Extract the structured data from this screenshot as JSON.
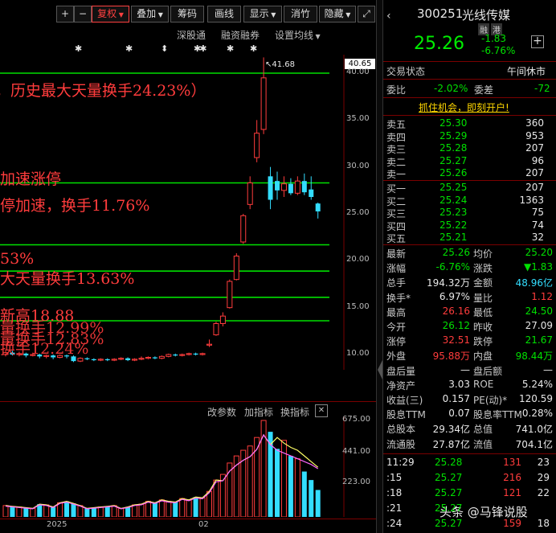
{
  "toolbar": {
    "plus": "+",
    "minus": "−",
    "fuquan": "复权",
    "overlay": "叠加",
    "chips": "筹码",
    "draw": "画线",
    "display": "显示",
    "review": "消竹",
    "hide": "隐藏",
    "fullscreen": "⤢"
  },
  "subtoolbar": {
    "shsz": "深股通",
    "margin": "融资融券",
    "settings": "设置均线"
  },
  "price_axis": {
    "current": "40.65",
    "labels": [
      "40.00",
      "35.00",
      "30.00",
      "25.00",
      "20.00",
      "15.00",
      "10.00"
    ]
  },
  "peak_label": "41.68",
  "annotations": [
    "，历史最大天量换手24.23%）",
    "加速涨停",
    "停加速，换手11.76%",
    "53%",
    "大天量换手13.63%",
    "新高18.88",
    "量换手12.99%",
    "量换手12.83%",
    "换手12.24%"
  ],
  "volume_panel": {
    "btn_params": "改参数",
    "btn_add": "加指标",
    "btn_switch": "换指标",
    "close": "✕",
    "labels": [
      "675.00",
      "441.00",
      "223.00"
    ]
  },
  "xaxis": {
    "year": "2025",
    "month": "02"
  },
  "stock": {
    "code": "300251",
    "name": "光线传媒",
    "badge1": "融",
    "badge2": "港",
    "price": "25.26",
    "change": "-1.83",
    "change_pct": "-6.76%"
  },
  "status": {
    "label": "交易状态",
    "value": "午间休市"
  },
  "ratio": {
    "wb_label": "委比",
    "wb_value": "-2.02%",
    "wc_label": "委差",
    "wc_value": "-72"
  },
  "promo": "抓住机会，即刻开户!",
  "asks": [
    {
      "label": "卖五",
      "price": "25.30",
      "vol": "360"
    },
    {
      "label": "卖四",
      "price": "25.29",
      "vol": "953"
    },
    {
      "label": "卖三",
      "price": "25.28",
      "vol": "207"
    },
    {
      "label": "卖二",
      "price": "25.27",
      "vol": "96"
    },
    {
      "label": "卖一",
      "price": "25.26",
      "vol": "207"
    }
  ],
  "bids": [
    {
      "label": "买一",
      "price": "25.25",
      "vol": "207"
    },
    {
      "label": "买二",
      "price": "25.24",
      "vol": "1363"
    },
    {
      "label": "买三",
      "price": "25.23",
      "vol": "75"
    },
    {
      "label": "买四",
      "price": "25.22",
      "vol": "74"
    },
    {
      "label": "买五",
      "price": "25.21",
      "vol": "32"
    }
  ],
  "stats": [
    {
      "l1": "最新",
      "v1": "25.26",
      "l2": "均价",
      "v2": "25.20"
    },
    {
      "l1": "涨幅",
      "v1": "-6.76%",
      "l2": "涨跌",
      "v2": "▼1.83"
    },
    {
      "l1": "总手",
      "v1": "194.32万",
      "l2": "金额",
      "v2": "48.96亿"
    },
    {
      "l1": "换手*",
      "v1": "6.97%",
      "l2": "量比",
      "v2": "1.12"
    },
    {
      "l1": "最高",
      "v1": "26.16",
      "l2": "最低",
      "v2": "24.50"
    },
    {
      "l1": "今开",
      "v1": "26.12",
      "l2": "昨收",
      "v2": "27.09"
    },
    {
      "l1": "涨停",
      "v1": "32.51",
      "l2": "跌停",
      "v2": "21.67"
    },
    {
      "l1": "外盘",
      "v1": "95.88万",
      "l2": "内盘",
      "v2": "98.44万"
    },
    {
      "l1": "盘后量",
      "v1": "—",
      "l2": "盘后额",
      "v2": "—"
    },
    {
      "l1": "净资产",
      "v1": "3.03",
      "l2": "ROE",
      "v2": "5.24%"
    },
    {
      "l1": "收益(三)",
      "v1": "0.157",
      "l2": "PE(动)*",
      "v2": "120.59"
    },
    {
      "l1": "股息TTM",
      "v1": "0.07",
      "l2": "股息率TTM",
      "v2": "0.28%"
    },
    {
      "l1": "总股本",
      "v1": "29.34亿",
      "l2": "总值",
      "v2": "741.0亿"
    },
    {
      "l1": "流通股",
      "v1": "27.87亿",
      "l2": "流值",
      "v2": "704.1亿"
    }
  ],
  "ticks": [
    {
      "t": "11:29",
      "p": "25.28",
      "v": "131",
      "n": "23"
    },
    {
      "t": ":15",
      "p": "25.27",
      "v": "216",
      "n": "29"
    },
    {
      "t": ":18",
      "p": "25.27",
      "v": "121",
      "n": "22"
    },
    {
      "t": ":21",
      "p": "25.27",
      "v": "",
      "n": ""
    },
    {
      "t": ":24",
      "p": "25.27",
      "v": "159",
      "n": "18"
    }
  ],
  "watermark": "头条 @马锋说股",
  "colors": {
    "up": "#ff3c3c",
    "down": "#33ddff",
    "line": "#00e000",
    "bg": "#000000"
  },
  "chart_data": {
    "type": "candlestick",
    "ylim": [
      9.5,
      41.68
    ],
    "candles": [
      {
        "o": 10.0,
        "c": 10.2,
        "h": 10.4,
        "l": 9.8
      },
      {
        "o": 10.2,
        "c": 10.0,
        "h": 10.4,
        "l": 9.9
      },
      {
        "o": 10.0,
        "c": 10.1,
        "h": 10.3,
        "l": 9.8
      },
      {
        "o": 10.1,
        "c": 9.9,
        "h": 10.2,
        "l": 9.7
      },
      {
        "o": 9.9,
        "c": 10.0,
        "h": 10.2,
        "l": 9.8
      },
      {
        "o": 10.0,
        "c": 9.8,
        "h": 10.1,
        "l": 9.6
      },
      {
        "o": 9.8,
        "c": 9.9,
        "h": 10.0,
        "l": 9.6
      },
      {
        "o": 9.9,
        "c": 9.7,
        "h": 10.0,
        "l": 9.5
      },
      {
        "o": 9.7,
        "c": 9.9,
        "h": 10.0,
        "l": 9.6
      },
      {
        "o": 9.9,
        "c": 9.8,
        "h": 10.0,
        "l": 9.6
      },
      {
        "o": 9.8,
        "c": 9.3,
        "h": 9.9,
        "l": 9.2
      },
      {
        "o": 9.3,
        "c": 9.6,
        "h": 9.7,
        "l": 9.2
      },
      {
        "o": 9.6,
        "c": 9.5,
        "h": 9.7,
        "l": 9.4
      },
      {
        "o": 9.5,
        "c": 9.4,
        "h": 9.6,
        "l": 9.3
      },
      {
        "o": 9.4,
        "c": 9.5,
        "h": 9.6,
        "l": 9.3
      },
      {
        "o": 9.5,
        "c": 9.4,
        "h": 9.6,
        "l": 9.3
      },
      {
        "o": 9.4,
        "c": 9.5,
        "h": 9.6,
        "l": 9.3
      },
      {
        "o": 9.5,
        "c": 9.6,
        "h": 9.7,
        "l": 9.4
      },
      {
        "o": 9.6,
        "c": 9.4,
        "h": 9.7,
        "l": 9.3
      },
      {
        "o": 9.4,
        "c": 9.5,
        "h": 9.6,
        "l": 9.3
      },
      {
        "o": 9.5,
        "c": 9.6,
        "h": 9.8,
        "l": 9.4
      },
      {
        "o": 9.6,
        "c": 9.7,
        "h": 9.8,
        "l": 9.5
      },
      {
        "o": 9.7,
        "c": 9.6,
        "h": 9.8,
        "l": 9.5
      },
      {
        "o": 9.6,
        "c": 9.8,
        "h": 9.9,
        "l": 9.5
      },
      {
        "o": 9.8,
        "c": 10.0,
        "h": 10.1,
        "l": 9.7
      },
      {
        "o": 10.0,
        "c": 9.9,
        "h": 10.1,
        "l": 9.8
      },
      {
        "o": 9.9,
        "c": 10.0,
        "h": 10.1,
        "l": 9.8
      },
      {
        "o": 10.0,
        "c": 10.1,
        "h": 10.2,
        "l": 9.9
      },
      {
        "o": 10.1,
        "c": 10.0,
        "h": 10.2,
        "l": 9.9
      },
      {
        "o": 10.0,
        "c": 10.1,
        "h": 10.2,
        "l": 9.9
      },
      {
        "o": 11.0,
        "c": 11.1,
        "h": 11.6,
        "l": 10.8
      },
      {
        "o": 12.1,
        "c": 13.3,
        "h": 13.5,
        "l": 12.0
      },
      {
        "o": 13.3,
        "c": 14.1,
        "h": 14.5,
        "l": 13.0
      },
      {
        "o": 15.0,
        "c": 17.8,
        "h": 18.0,
        "l": 14.9
      },
      {
        "o": 18.0,
        "c": 20.5,
        "h": 20.8,
        "l": 17.9
      },
      {
        "o": 22.0,
        "c": 24.8,
        "h": 25.0,
        "l": 21.8
      },
      {
        "o": 26.0,
        "c": 28.3,
        "h": 29.0,
        "l": 25.5
      },
      {
        "o": 31.0,
        "c": 33.6,
        "h": 35.0,
        "l": 30.5
      },
      {
        "o": 34.0,
        "c": 39.5,
        "h": 41.68,
        "l": 33.5
      },
      {
        "o": 29.0,
        "c": 26.5,
        "h": 30.0,
        "l": 25.5
      },
      {
        "o": 28.5,
        "c": 27.5,
        "h": 29.5,
        "l": 26.5
      },
      {
        "o": 27.5,
        "c": 28.2,
        "h": 29.0,
        "l": 26.8
      },
      {
        "o": 28.2,
        "c": 27.2,
        "h": 28.8,
        "l": 27.0
      },
      {
        "o": 27.2,
        "c": 28.5,
        "h": 29.0,
        "l": 27.0
      },
      {
        "o": 28.5,
        "c": 27.3,
        "h": 29.3,
        "l": 27.0
      },
      {
        "o": 27.6,
        "c": 26.8,
        "h": 29.0,
        "l": 26.5
      },
      {
        "o": 26.1,
        "c": 25.26,
        "h": 26.2,
        "l": 24.5
      }
    ],
    "h_lines": [
      40.0,
      28.3,
      21.7,
      18.9,
      16.1,
      13.6
    ],
    "volume": [
      80,
      75,
      70,
      65,
      60,
      90,
      85,
      70,
      100,
      110,
      95,
      80,
      60,
      65,
      70,
      75,
      80,
      60,
      70,
      85,
      90,
      110,
      100,
      120,
      110,
      105,
      130,
      120,
      140,
      135,
      180,
      260,
      300,
      380,
      430,
      470,
      500,
      560,
      680,
      600,
      480,
      540,
      430,
      410,
      320,
      260,
      190
    ],
    "ma_fast": [
      560,
      520,
      490,
      470,
      430,
      390,
      350
    ],
    "ma_slow": [
      470,
      450,
      430,
      410,
      390,
      370,
      340
    ]
  }
}
